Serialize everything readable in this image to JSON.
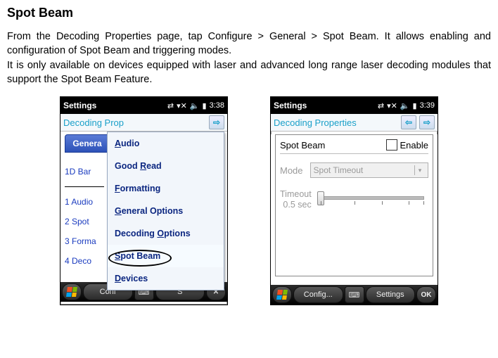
{
  "doc": {
    "heading": "Spot Beam",
    "p1": "From the Decoding Properties page, tap Configure > General > Spot Beam. It allows enabling and configuration of Spot Beam and triggering modes.",
    "p2": "It is only available on devices equipped with laser and advanced long range laser decoding modules that support the Spot Beam Feature."
  },
  "left": {
    "status_title": "Settings",
    "time": "3:38",
    "nav_label": "Decoding Prop",
    "tab_label": "Genera",
    "side_items": [
      "1D Bar",
      "1 Audio",
      "2 Spot",
      "3 Forma",
      "4 Deco"
    ],
    "menu_items": [
      "Audio",
      "Good Read",
      "Formatting",
      "General Options",
      "Decoding Options",
      "Spot Beam",
      "Devices"
    ],
    "soft_left": "Conf",
    "soft_right": "S"
  },
  "right": {
    "status_title": "Settings",
    "time": "3:39",
    "nav_label": "Decoding Properties",
    "panel_title": "Spot Beam",
    "enable_label": "Enable",
    "mode_label": "Mode",
    "mode_value": "Spot Timeout",
    "timeout_label_l1": "Timeout",
    "timeout_label_l2": "0.5 sec",
    "soft_left": "Config...",
    "soft_right": "Settings",
    "ok": "OK"
  }
}
